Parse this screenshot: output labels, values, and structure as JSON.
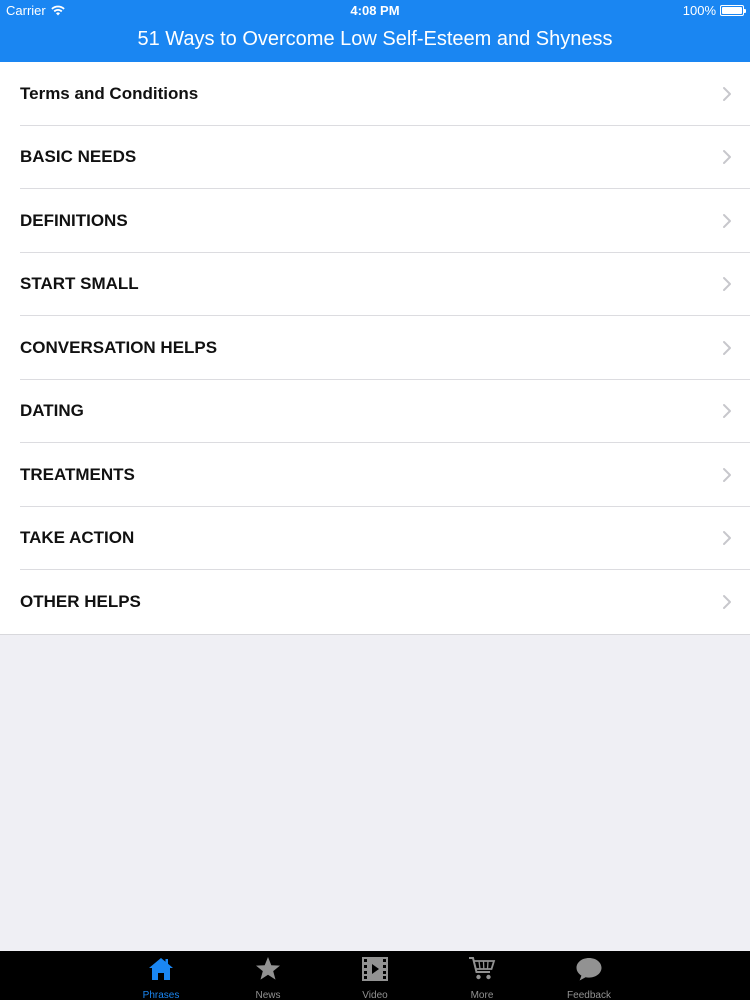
{
  "status_bar": {
    "carrier": "Carrier",
    "time": "4:08 PM",
    "battery": "100%",
    "battery_level": 1.0
  },
  "nav": {
    "title": "51 Ways to Overcome Low Self-Esteem and Shyness"
  },
  "list": {
    "items": [
      {
        "label": "Terms and Conditions"
      },
      {
        "label": "BASIC NEEDS"
      },
      {
        "label": "DEFINITIONS"
      },
      {
        "label": "START SMALL"
      },
      {
        "label": "CONVERSATION HELPS"
      },
      {
        "label": "DATING"
      },
      {
        "label": "TREATMENTS"
      },
      {
        "label": "TAKE ACTION"
      },
      {
        "label": "OTHER HELPS"
      }
    ],
    "accessory_icon": "chevron-right-icon"
  },
  "tab_bar": {
    "active_index": 0,
    "tabs": [
      {
        "label": "Phrases",
        "icon": "home-icon"
      },
      {
        "label": "News",
        "icon": "star-icon"
      },
      {
        "label": "Video",
        "icon": "film-icon"
      },
      {
        "label": "More",
        "icon": "cart-icon"
      },
      {
        "label": "Feedback",
        "icon": "speech-bubble-icon"
      }
    ]
  },
  "colors": {
    "accent": "#1a86f2",
    "tab_inactive": "#929292",
    "background": "#efeff4"
  }
}
